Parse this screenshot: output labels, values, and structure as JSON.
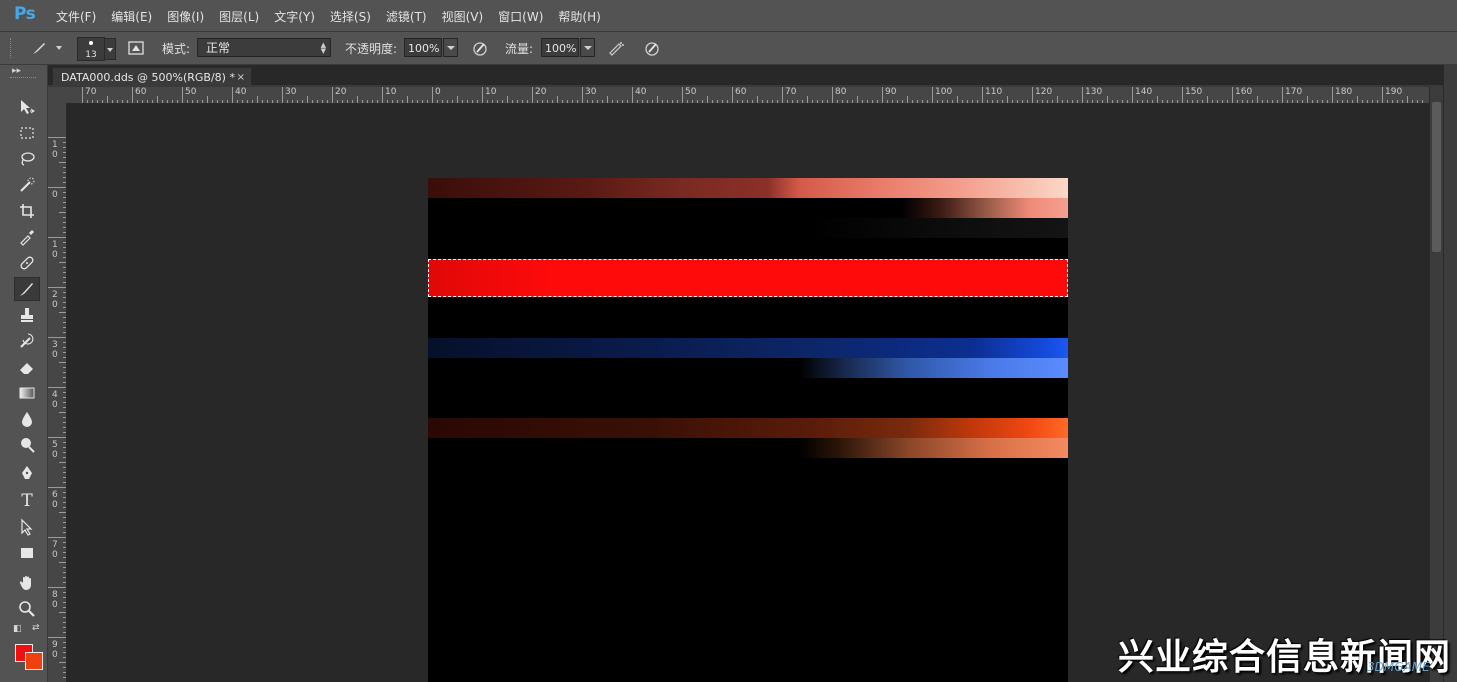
{
  "app": {
    "logo": "Ps"
  },
  "menu": [
    "文件(F)",
    "编辑(E)",
    "图像(I)",
    "图层(L)",
    "文字(Y)",
    "选择(S)",
    "滤镜(T)",
    "视图(V)",
    "窗口(W)",
    "帮助(H)"
  ],
  "options": {
    "brush_size": "13",
    "mode_label": "模式:",
    "mode_value": "正常",
    "opacity_label": "不透明度:",
    "opacity_value": "100%",
    "flow_label": "流量:",
    "flow_value": "100%"
  },
  "document": {
    "tab_title": "DATA000.dds @ 500%(RGB/8) *",
    "close": "×"
  },
  "ruler": {
    "h_labels": [
      "70",
      "60",
      "50",
      "40",
      "30",
      "20",
      "10",
      "0",
      "10",
      "20",
      "30",
      "40",
      "50",
      "60",
      "70",
      "80",
      "90",
      "100",
      "110",
      "120",
      "130",
      "140",
      "150",
      "160",
      "170",
      "180",
      "190"
    ],
    "v_labels": [
      "1\n0",
      "0",
      "1\n0",
      "2\n0",
      "3\n0",
      "4\n0",
      "5\n0",
      "6\n0",
      "7\n0",
      "8\n0",
      "9\n0"
    ]
  },
  "colors": {
    "foreground": "#f01010",
    "background": "#f04010",
    "accent": "#4aa7e6"
  },
  "tools": [
    "move-tool",
    "marquee-tool",
    "lasso-tool",
    "quick-selection-tool",
    "crop-tool",
    "eyedropper-tool",
    "healing-brush-tool",
    "brush-tool",
    "clone-stamp-tool",
    "history-brush-tool",
    "eraser-tool",
    "gradient-tool",
    "blur-tool",
    "dodge-tool",
    "pen-tool",
    "type-tool",
    "path-selection-tool",
    "rectangle-tool",
    "hand-tool",
    "zoom-tool"
  ],
  "type_tool_glyph": "T",
  "watermark": {
    "text": "兴业综合信息新闻网",
    "small": "3DMGAME"
  }
}
